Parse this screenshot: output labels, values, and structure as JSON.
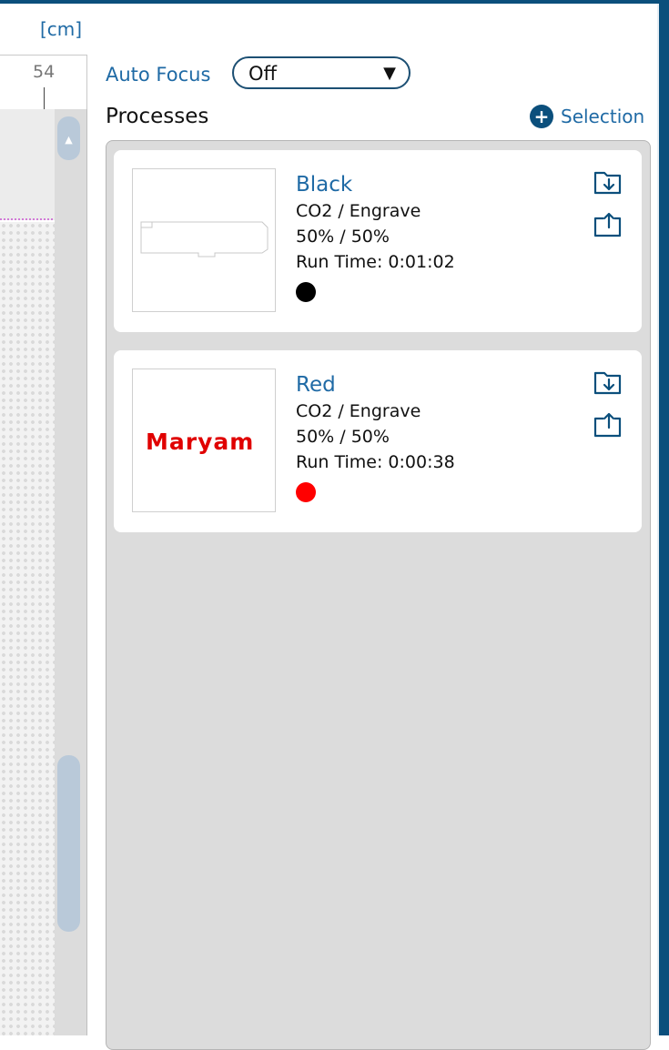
{
  "ruler": {
    "unit": "[cm]",
    "mark": "54"
  },
  "auto_focus": {
    "label": "Auto Focus",
    "value": "Off"
  },
  "processes": {
    "title": "Processes",
    "selection_label": "Selection",
    "items": [
      {
        "name": "Black",
        "laser": "CO2 / Engrave",
        "power": "50%  /  50%",
        "run_time": "Run Time: 0:01:02",
        "color": "#000000",
        "thumb_text": ""
      },
      {
        "name": "Red",
        "laser": "CO2 / Engrave",
        "power": "50%  /  50%",
        "run_time": "Run Time: 0:00:38",
        "color": "#ff0000",
        "thumb_text": "Maryam"
      }
    ]
  },
  "icons": {
    "add": "plus-circle-icon",
    "import": "folder-import-icon",
    "export": "folder-export-icon"
  }
}
